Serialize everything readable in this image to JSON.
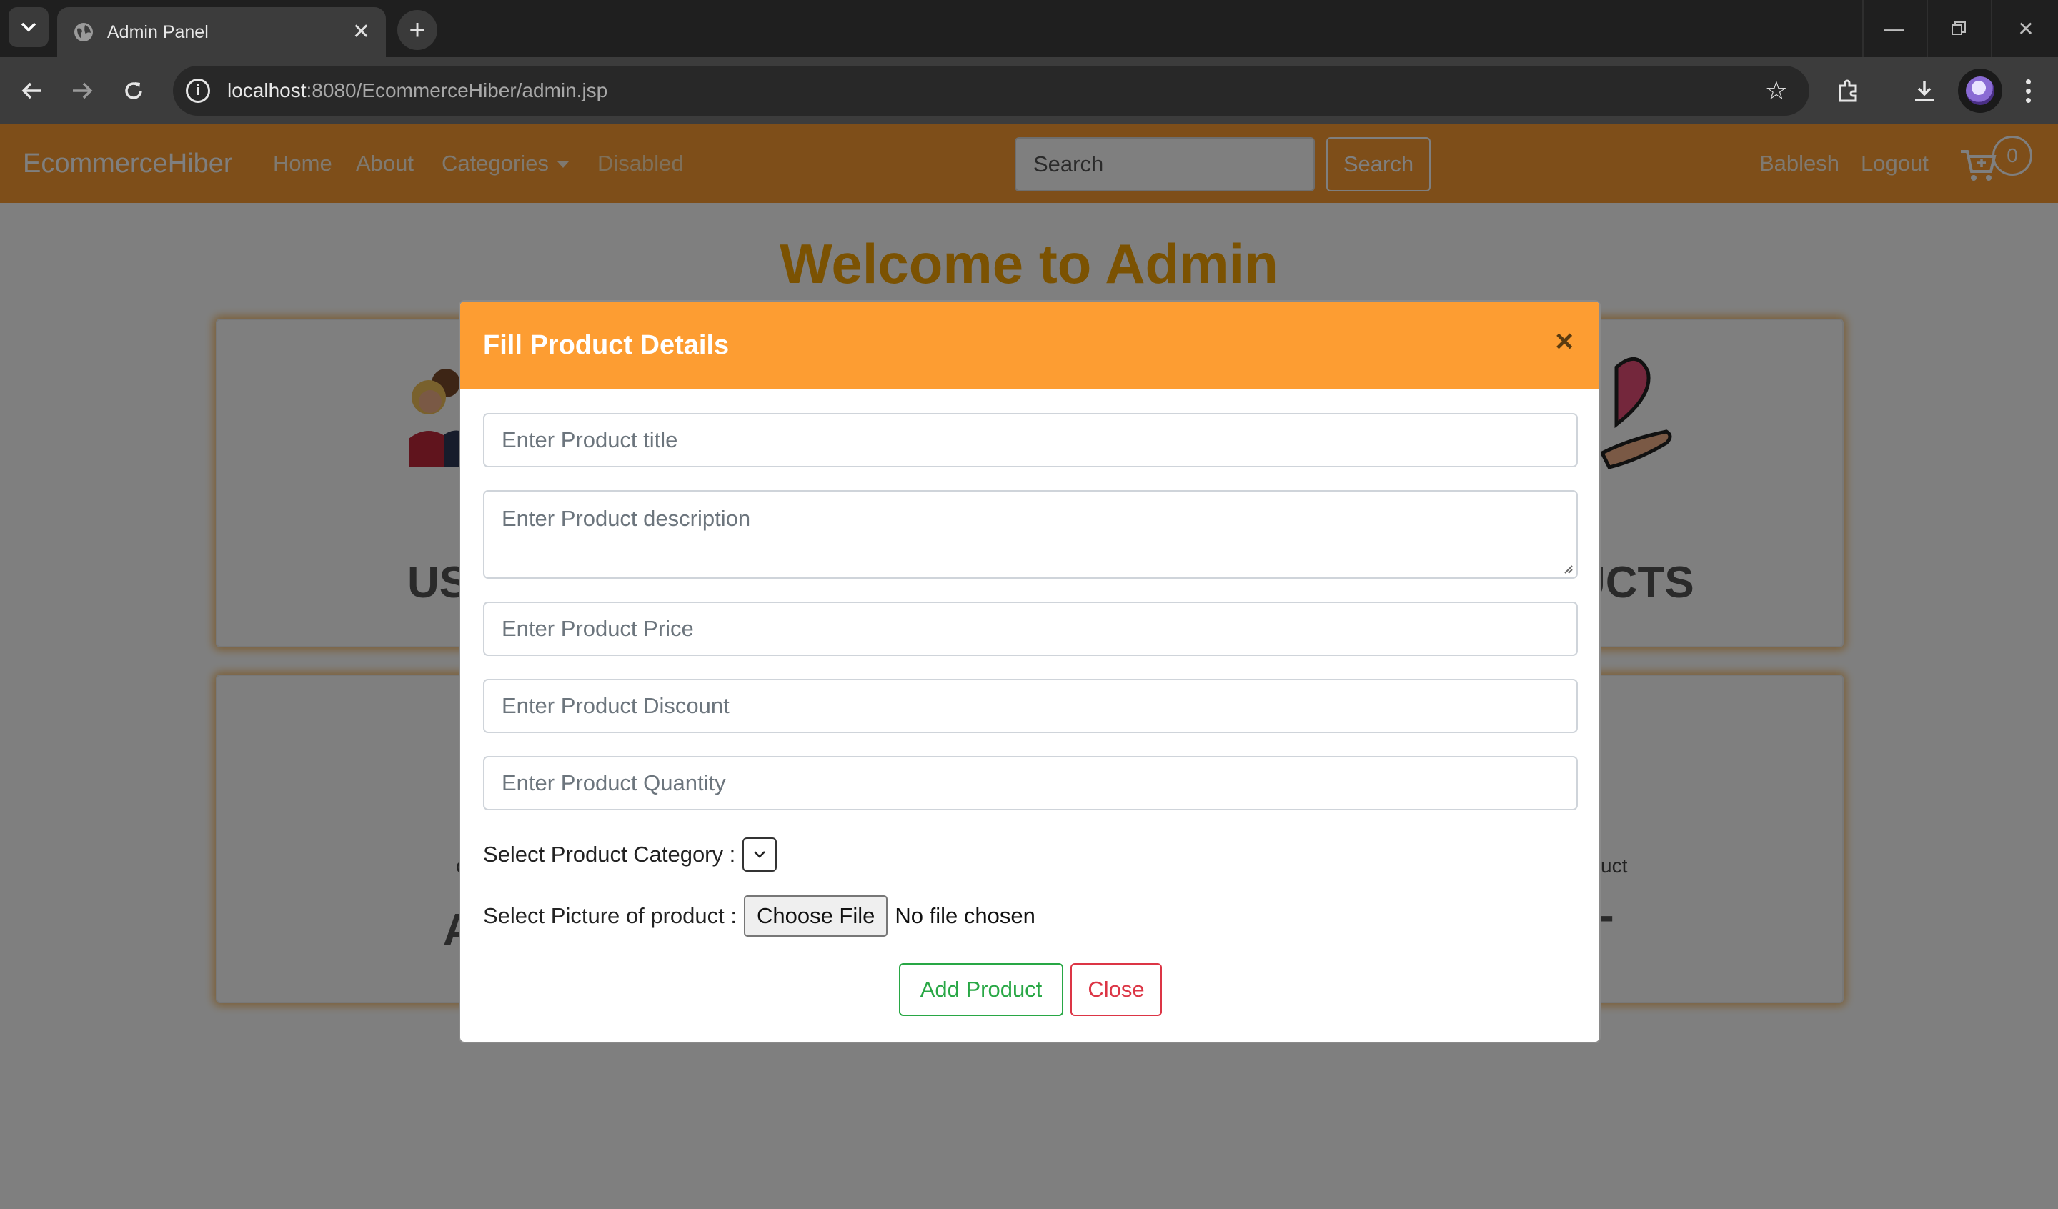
{
  "browser": {
    "tab_title": "Admin Panel",
    "url_host": "localhost",
    "url_path": ":8080/EcommerceHiber/admin.jsp"
  },
  "navbar": {
    "brand": "EcommerceHiber",
    "links": [
      "Home",
      "About",
      "Categories",
      "Disabled"
    ],
    "search_placeholder": "Search",
    "search_button": "Search",
    "user": "Bablesh",
    "logout": "Logout",
    "cart_count": "0"
  },
  "page": {
    "welcome": "Welcome to Admin",
    "card_users_title": "US",
    "card_products_title": "UCTS",
    "card_left_bottom_title": "A",
    "card_right_bottom_small": "uct",
    "card_left_bottom_small": "c",
    "card_right_bottom_title": "-"
  },
  "modal": {
    "title": "Fill Product Details",
    "title_placeholder": "Enter Product title",
    "description_placeholder": "Enter Product description",
    "price_placeholder": "Enter Product Price",
    "discount_placeholder": "Enter Product Discount",
    "quantity_placeholder": "Enter Product Quantity",
    "category_label": "Select Product Category :",
    "picture_label": "Select Picture of product :",
    "choose_file": "Choose File",
    "no_file": "No file chosen",
    "add_button": "Add Product",
    "close_button": "Close"
  }
}
